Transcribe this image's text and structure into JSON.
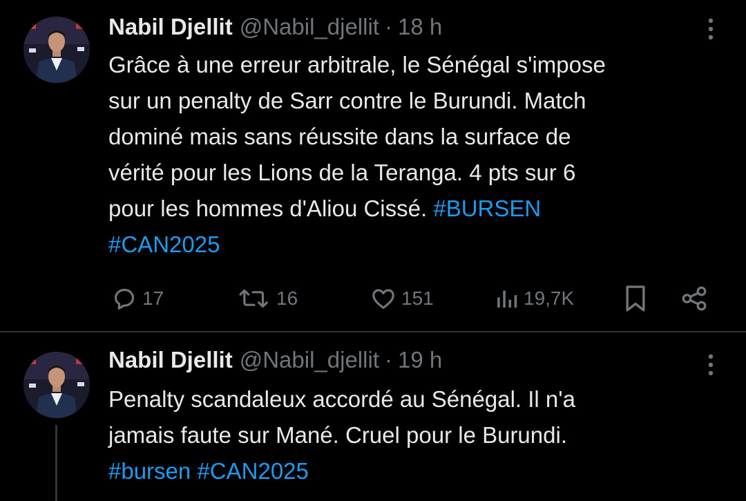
{
  "tweets": [
    {
      "author_name": "Nabil Djellit",
      "handle": "@Nabil_djellit",
      "separator": "·",
      "time": "18 h",
      "text_lines": [
        "Grâce à une erreur arbitrale, le Sénégal s'impose",
        "sur un penalty de Sarr contre le Burundi. Match",
        "dominé mais sans réussite dans la surface de",
        "vérité pour les Lions de la Teranga. 4 pts sur 6",
        "pour les hommes d'Aliou Cissé. "
      ],
      "hashtags": [
        "#BURSEN",
        "#CAN2025"
      ],
      "actions": {
        "replies": "17",
        "reposts": "16",
        "likes": "151",
        "views": "19,7K"
      },
      "icons": [
        "reply-icon",
        "repost-icon",
        "like-icon",
        "views-icon",
        "bookmark-icon",
        "share-icon",
        "more-icon"
      ]
    },
    {
      "author_name": "Nabil Djellit",
      "handle": "@Nabil_djellit",
      "separator": "·",
      "time": "19 h",
      "text_lines": [
        "Penalty scandaleux accordé au Sénégal. Il n'a",
        "jamais faute sur Mané. Cruel pour le Burundi."
      ],
      "hashtags": [
        "#bursen",
        "#CAN2025"
      ],
      "icons": [
        "more-icon"
      ]
    }
  ],
  "colors": {
    "background": "#000000",
    "text": "#e7e9ea",
    "secondary": "#71767b",
    "link": "#1d9bf0",
    "divider": "#2f3336"
  }
}
